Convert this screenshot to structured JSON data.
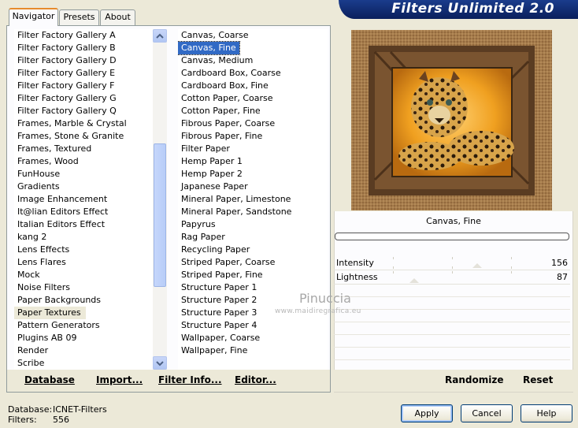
{
  "banner": {
    "title": "Filters Unlimited 2.0"
  },
  "tabs": [
    {
      "label": "Navigator",
      "active": true
    },
    {
      "label": "Presets",
      "active": false
    },
    {
      "label": "About",
      "active": false
    }
  ],
  "categories": {
    "items": [
      "Filter Factory Gallery A",
      "Filter Factory Gallery B",
      "Filter Factory Gallery D",
      "Filter Factory Gallery E",
      "Filter Factory Gallery F",
      "Filter Factory Gallery G",
      "Filter Factory Gallery Q",
      "Frames, Marble & Crystal",
      "Frames, Stone & Granite",
      "Frames, Textured",
      "Frames, Wood",
      "FunHouse",
      "Gradients",
      "Image Enhancement",
      "It@lian Editors Effect",
      "Italian Editors Effect",
      "kang 2",
      "Lens Effects",
      "Lens Flares",
      "Mock",
      "Noise Filters",
      "Paper Backgrounds",
      "Paper Textures",
      "Pattern Generators",
      "Plugins AB 09",
      "Render",
      "Scribe"
    ],
    "selected": "Paper Textures"
  },
  "filters": {
    "items": [
      "Canvas, Coarse",
      "Canvas, Fine",
      "Canvas, Medium",
      "Cardboard Box, Coarse",
      "Cardboard Box, Fine",
      "Cotton Paper, Coarse",
      "Cotton Paper, Fine",
      "Fibrous Paper, Coarse",
      "Fibrous Paper, Fine",
      "Filter Paper",
      "Hemp Paper 1",
      "Hemp Paper 2",
      "Japanese Paper",
      "Mineral Paper, Limestone",
      "Mineral Paper, Sandstone",
      "Papyrus",
      "Rag Paper",
      "Recycling Paper",
      "Striped Paper, Coarse",
      "Striped Paper, Fine",
      "Structure Paper 1",
      "Structure Paper 2",
      "Structure Paper 3",
      "Structure Paper 4",
      "Wallpaper, Coarse",
      "Wallpaper, Fine"
    ],
    "selected": "Canvas, Fine"
  },
  "left_buttons": {
    "database": "Database",
    "import": "Import...",
    "filter_info": "Filter Info...",
    "editor": "Editor..."
  },
  "preview": {
    "filter_name": "Canvas, Fine",
    "params": [
      {
        "label": "Intensity",
        "value": "156"
      },
      {
        "label": "Lightness",
        "value": "87"
      }
    ]
  },
  "right_buttons": {
    "randomize": "Randomize",
    "reset": "Reset"
  },
  "watermark": {
    "name": "Pinuccia",
    "url": "www.maidiregrafica.eu"
  },
  "status": {
    "database_label": "Database:",
    "database_value": "ICNET-Filters",
    "filters_label": "Filters:",
    "filters_value": "556"
  },
  "dialog_buttons": {
    "apply": "Apply",
    "cancel": "Cancel",
    "help": "Help"
  },
  "colors": {
    "selection_blue": "#316ac5",
    "banner": "#1a3c8c",
    "window_bg": "#ece9d8"
  }
}
